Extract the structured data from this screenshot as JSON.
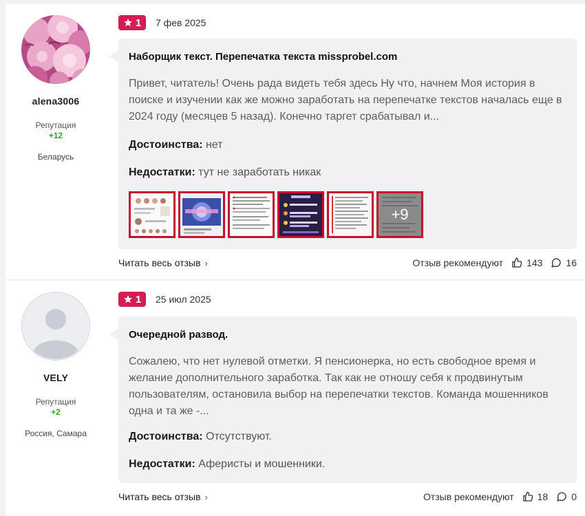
{
  "reviews": [
    {
      "author": {
        "name": "alena3006",
        "reputation_label": "Репутация",
        "reputation_value": "+12",
        "location": "Беларусь",
        "avatar": "peony-flowers-photo"
      },
      "rating": "1",
      "date": "7 фев 2025",
      "title": "Наборщик текст. Перепечатка текста missprobel.com",
      "excerpt": "Привет, читатель! Очень рада видеть тебя здесь Ну что, начнем Моя история в поиске и изучении как же можно заработать на перепечатке текстов началась еще в 2024 году (месяцев 5 назад). Конечно таргет срабатывал и...",
      "pros_label": "Достоинства:",
      "pros": "нет",
      "cons_label": "Недостатки:",
      "cons": "тут не заработать никак",
      "more_photos": "+9",
      "read_more": "Читать весь отзыв",
      "recommend_label": "Отзыв рекомендуют",
      "likes": "143",
      "comments": "16"
    },
    {
      "author": {
        "name": "VELY",
        "reputation_label": "Репутация",
        "reputation_value": "+2",
        "location": "Россия, Самара",
        "avatar": "default-user-avatar"
      },
      "rating": "1",
      "date": "25 июл 2025",
      "title": "Очередной развод.",
      "excerpt": "Сожалею, что нет нулевой отметки. Я пенсионерка, но есть свободное время и желание дополнительного заработка. Так как не отношу себя к продвинутым пользователям, остановила выбор на перепечатки текстов. Команда мошенников одна и та же -...",
      "pros_label": "Достоинства:",
      "pros": "Отсутствуют.",
      "cons_label": "Недостатки:",
      "cons": "Аферисты и мошенники.",
      "read_more": "Читать весь отзыв",
      "recommend_label": "Отзыв рекомендуют",
      "likes": "18",
      "comments": "0"
    }
  ],
  "colors": {
    "rating_badge": "#d11f55",
    "reputation": "#2aa82a",
    "bubble": "#f1f1f3",
    "page_bg": "#f2f2f4"
  },
  "icons": {
    "rating": "star-icon",
    "likes": "thumbs-up-icon",
    "comments": "comment-icon",
    "read_more": "chevron-right-icon"
  }
}
